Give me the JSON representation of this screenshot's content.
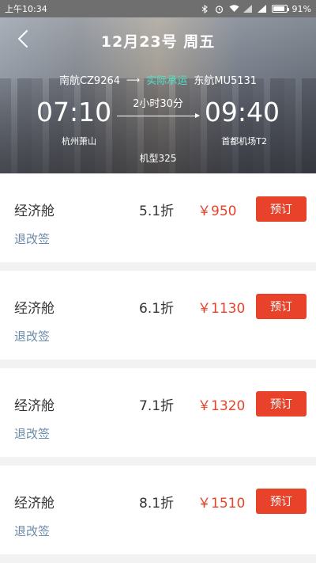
{
  "status_bar": {
    "time": "上午10:34",
    "battery": "91%",
    "battery_level": 0.91,
    "icons": [
      "bluetooth-icon",
      "alarm-icon",
      "wifi-icon",
      "signal-icon",
      "signal-icon",
      "battery-icon"
    ]
  },
  "header": {
    "title": "12月23号 周五",
    "back_icon": "chevron-left-icon",
    "flight_left": "南航CZ9264",
    "arrow": "⟶",
    "actual_label": "实际承运",
    "flight_right": "东航MU5131",
    "dep_time": "07:10",
    "arr_time": "09:40",
    "duration": "2小时30分",
    "dep_airport": "杭州萧山",
    "arr_airport": "首都机场T2",
    "aircraft": "机型325"
  },
  "cabins": [
    {
      "name": "经济舱",
      "discount": "5.1折",
      "price": "￥950",
      "book": "预订",
      "refund": "退改签"
    },
    {
      "name": "经济舱",
      "discount": "6.1折",
      "price": "￥1130",
      "book": "预订",
      "refund": "退改签"
    },
    {
      "name": "经济舱",
      "discount": "7.1折",
      "price": "￥1320",
      "book": "预订",
      "refund": "退改签"
    },
    {
      "name": "经济舱",
      "discount": "8.1折",
      "price": "￥1510",
      "book": "预订",
      "refund": "退改签"
    }
  ],
  "colors": {
    "accent": "#e8432a",
    "actual_carrier": "#4fe0c8",
    "link": "#6a8aa8"
  }
}
